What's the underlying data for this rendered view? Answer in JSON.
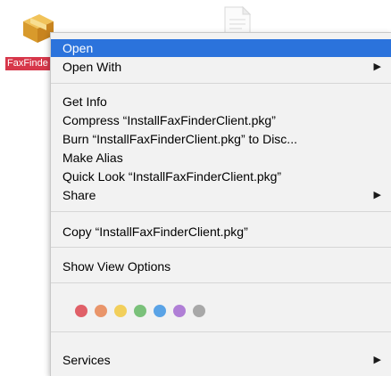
{
  "desktop": {
    "selected_file_label": "FaxFinde",
    "selected_file_icon": "package-box-icon",
    "neighbor_file_icon": "document-icon"
  },
  "menu": {
    "items": [
      {
        "label": "Open",
        "highlighted": true
      },
      {
        "label": "Open With",
        "submenu": true
      },
      {
        "label": "Get Info"
      },
      {
        "label": "Compress “InstallFaxFinderClient.pkg”"
      },
      {
        "label": "Burn “InstallFaxFinderClient.pkg” to Disc..."
      },
      {
        "label": "Make Alias"
      },
      {
        "label": "Quick Look “InstallFaxFinderClient.pkg”"
      },
      {
        "label": "Share",
        "submenu": true
      },
      {
        "label": "Copy “InstallFaxFinderClient.pkg”"
      },
      {
        "label": "Show View Options"
      },
      {
        "label": "Services",
        "submenu": true
      }
    ],
    "submenu_arrow_icon": "triangle-right-icon",
    "highlight_color": "#2b73dc",
    "tag_colors": [
      "#e06068",
      "#e9956a",
      "#f2cf5b",
      "#7ac17a",
      "#5aa3e6",
      "#b07fd6",
      "#a8a8a8"
    ]
  }
}
